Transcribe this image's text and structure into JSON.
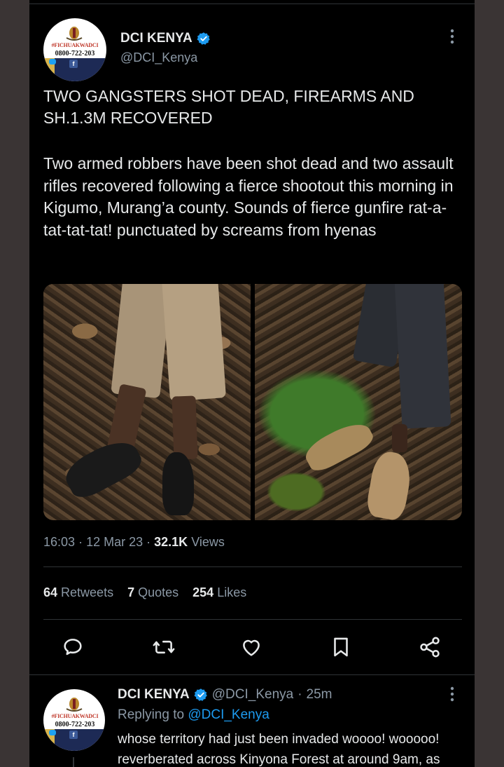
{
  "tweet": {
    "author_name": "DCI KENYA",
    "author_handle": "@DCI_Kenya",
    "avatar": {
      "tag": "#FICHUAKWADCI",
      "phone": "0800-722-203"
    },
    "headline": "TWO GANGSTERS SHOT DEAD, FIREARMS AND SH.1.3M RECOVERED",
    "body": "Two armed robbers have been shot dead and two assault rifles recovered following a fierce shootout this morning in Kigumo, Murang’a county. Sounds of fierce gunfire rat-a-tat-tat-tat! punctuated by screams from hyenas",
    "time": "16:03",
    "date": "12 Mar 23",
    "views_count": "32.1K",
    "views_label": "Views",
    "retweets_count": "64",
    "retweets_label": "Retweets",
    "quotes_count": "7",
    "quotes_label": "Quotes",
    "likes_count": "254",
    "likes_label": "Likes"
  },
  "icons": {
    "verified": "verified-badge-icon",
    "more": "more-options-icon",
    "reply": "reply-icon",
    "retweet": "retweet-icon",
    "like": "heart-icon",
    "bookmark": "bookmark-icon",
    "share": "share-icon"
  },
  "reply": {
    "author_name": "DCI KENYA",
    "author_handle": "@DCI_Kenya",
    "elapsed": "25m",
    "replying_to_label": "Replying to",
    "replying_to_handle": "@DCI_Kenya",
    "text": "whose territory had just been invaded woooo! wooooo! reverberated across Kinyona Forest at around 9am, as"
  },
  "colors": {
    "background": "#000000",
    "text": "#e7e9ea",
    "secondary_text": "#8b98a5",
    "accent": "#1d9bf0",
    "divider": "#2f3336"
  }
}
